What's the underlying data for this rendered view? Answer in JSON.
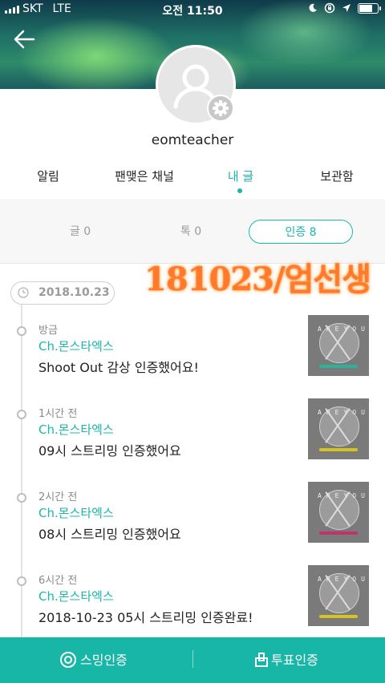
{
  "status_bar": {
    "carrier": "SKT",
    "network": "LTE",
    "time": "오전 11:50"
  },
  "profile": {
    "username": "eomteacher"
  },
  "tabs": [
    {
      "label": "알림"
    },
    {
      "label": "팬맺은 채널"
    },
    {
      "label": "내 글"
    },
    {
      "label": "보관함"
    }
  ],
  "active_tab": 2,
  "subtabs": [
    {
      "label": "글 0"
    },
    {
      "label": "톡 0"
    },
    {
      "label": "인증 8"
    }
  ],
  "date_label": "2018.10.23",
  "watermark": "181023/엄선생",
  "feed": [
    {
      "time": "방금",
      "channel": "Ch.몬스타엑스",
      "text": "Shoot Out 감상 인증했어요!",
      "band_color": "#2ab39a"
    },
    {
      "time": "1시간 전",
      "channel": "Ch.몬스타엑스",
      "text": "09시 스트리밍 인증했어요",
      "band_color": "#d8c21e"
    },
    {
      "time": "2시간 전",
      "channel": "Ch.몬스타엑스",
      "text": "08시 스트리밍 인증했어요",
      "band_color": "#c2326a"
    },
    {
      "time": "6시간 전",
      "channel": "Ch.몬스타엑스",
      "text": "2018-10-23 05시 스트리밍 인증완료!",
      "band_color": "#d8c21e"
    }
  ],
  "thumb_text": "AREYOUTHERE?",
  "bottom_bar": {
    "streaming_label": "스밍인증",
    "vote_label": "투표인증"
  },
  "colors": {
    "accent": "#1bb7a8",
    "bottom_bar": "#17b6a6",
    "watermark": "#ff7a2a"
  }
}
